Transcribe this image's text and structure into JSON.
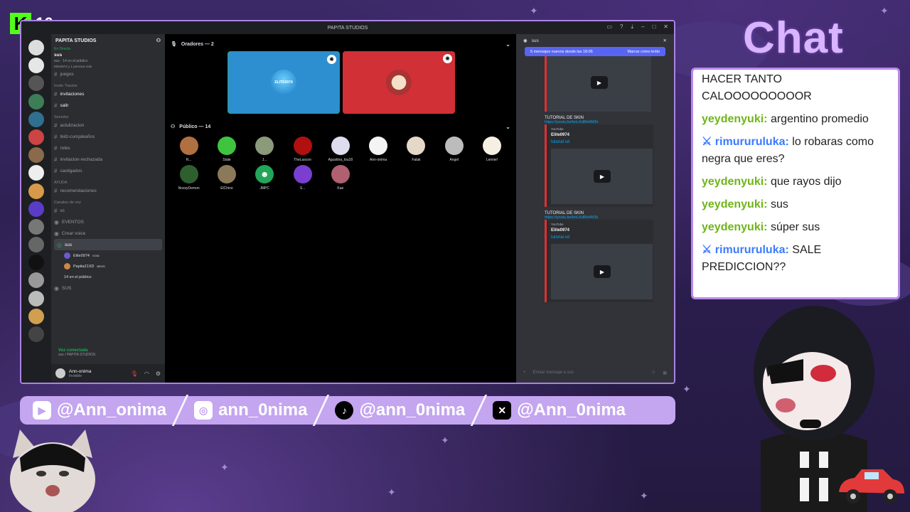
{
  "overlay": {
    "k_number": "16",
    "chat_title": "Chat",
    "socials": [
      {
        "icon": "youtube-icon",
        "text": "@Ann_onima"
      },
      {
        "icon": "instagram-icon",
        "text": "ann_0nima"
      },
      {
        "icon": "tiktok-icon",
        "text": "@ann_0nima"
      },
      {
        "icon": "x-icon",
        "text": "@Ann_0nima"
      }
    ],
    "chat": [
      {
        "user": "",
        "text": "HACER TANTO CALOOOOOOOOOR"
      },
      {
        "user": "yeydenyuki:",
        "text": "argentino promedio"
      },
      {
        "user": "rimururuluka:",
        "text": "lo robaras como negra que eres?"
      },
      {
        "user": "yeydenyuki:",
        "text": "que rayos dijo"
      },
      {
        "user": "yeydenyuki:",
        "text": "sus"
      },
      {
        "user": "yeydenyuki:",
        "text": "súper sus"
      },
      {
        "user": "rimururuluka:",
        "text": "SALE PREDICCION??"
      }
    ]
  },
  "discord": {
    "window_title": "PAPITA STUDIOS",
    "guild": "PAPITA STUDIOS",
    "live_label": "En Directo",
    "live_channel": "sus",
    "live_sub": "sus · 14 en el público",
    "live_sub2": "Elite0974 y 1 persona más",
    "channels_top": [
      "juegos"
    ],
    "cat_invite": "Invite Tracker",
    "invite_channels": [
      "invitaciones",
      "salir"
    ],
    "cat_server": "Servidor",
    "server_channels": [
      "actulizacion",
      "feliz-cumpleaños",
      "roles",
      "invitacion-rechazada",
      "castigados"
    ],
    "cat_help": "AYUDA",
    "help_channels": [
      "recomendaciones"
    ],
    "cat_voice": "Canales de voz",
    "voice_channels": [
      "vc",
      "EVENTOS",
      "Crear voice"
    ],
    "stage_channel": "sus",
    "stage_sub": "sus",
    "stage_users": [
      "Elite0974",
      "Papita21XD",
      "14 en el público"
    ],
    "stage_badge1": "VOID",
    "stage_badge2": "BROS",
    "extra_channel": "SUS",
    "voice_connected": "Voz conectada",
    "voice_where": "sus / PAPITA STUDIOS",
    "user_name": "Ann-onima",
    "user_status": "Invisible",
    "speakers_label": "Oradores — 2",
    "audience_label": "Público — 14",
    "speaker1_text": "ELITE0974",
    "audience": [
      "R...",
      "Stale",
      "J...",
      "TheLascon",
      "Agustina_lou18",
      "Ann-onima",
      "Falak",
      "Angel",
      "Lennie!",
      "NossyDemon",
      "ElChino",
      "JMPC",
      "S...",
      "Kae"
    ],
    "chat_channel": "sus",
    "new_msgs": "5 mensajes nuevos desde las 18:06",
    "mark_read": "Marcar como leído",
    "msg_title": "TUTORIAL DE SKIN",
    "msg_link": "https://youtu.be/bnLKdBb4M3k",
    "embed_provider": "YouTube",
    "embed_author": "Elite0974",
    "embed_title": "tutorial xd",
    "input_placeholder": "Enviar mensaje a sus"
  }
}
